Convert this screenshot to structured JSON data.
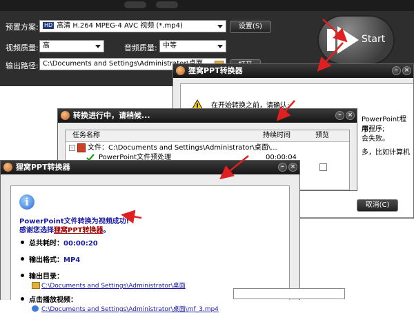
{
  "main": {
    "preset_label": "预置方案:",
    "preset_badge": "HD",
    "preset_value": "高清 H.264 MPEG-4 AVC 视频 (*.mp4)",
    "settings_btn": "设置(S)",
    "video_quality_label": "视频质量:",
    "video_quality_value": "高",
    "audio_quality_label": "音频质量:",
    "audio_quality_value": "中等",
    "output_label": "输出路径:",
    "output_value": "C:\\Documents and Settings\\Administrator\\桌面",
    "open_btn": "打开",
    "start_label": "Start"
  },
  "confirm_dialog": {
    "title": "狸窝PPT转换器",
    "prompt": "在开始转换之前，请确认:",
    "line1": "PowerPoint程序;",
    "line2": "用程序;",
    "line3": "会失败。",
    "line4": "多，比如计算机",
    "cancel_btn": "取消(C)"
  },
  "progress_dialog": {
    "title": "转换进行中，请稍候...",
    "col_task": "任务名称",
    "col_duration": "持续时间",
    "col_preview": "预览",
    "row1_text": "文件：C:\\Documents and Settings\\Administrator\\桌面\\...",
    "row2_text": "PowerPoint文件预处理",
    "row2_duration": "00:00:04"
  },
  "success_dialog": {
    "title": "狸窝PPT转换器",
    "info_icon_glyph": "i",
    "success_msg": "PowerPoint文件转换为视频成功!",
    "thanks_prefix": "感谢您选择",
    "thanks_product": "狸窝PPT转换器",
    "thanks_suffix": "。",
    "elapsed_label": "总共耗时：",
    "elapsed_value": "00:00:20",
    "format_label": "输出格式：",
    "format_value": "MP4",
    "dir_label": "输出目录：",
    "dir_link": "C:\\Documents and Settings\\Administrator\\桌面",
    "play_label": "点击播放视频：",
    "video_link": "C:\\Documents and Settings\\Administrator\\桌面\\mf_3.mp4"
  },
  "colors": {
    "accent_red": "#e02020",
    "link_blue": "#1a1aa8",
    "titlebar_dark": "#161616"
  }
}
